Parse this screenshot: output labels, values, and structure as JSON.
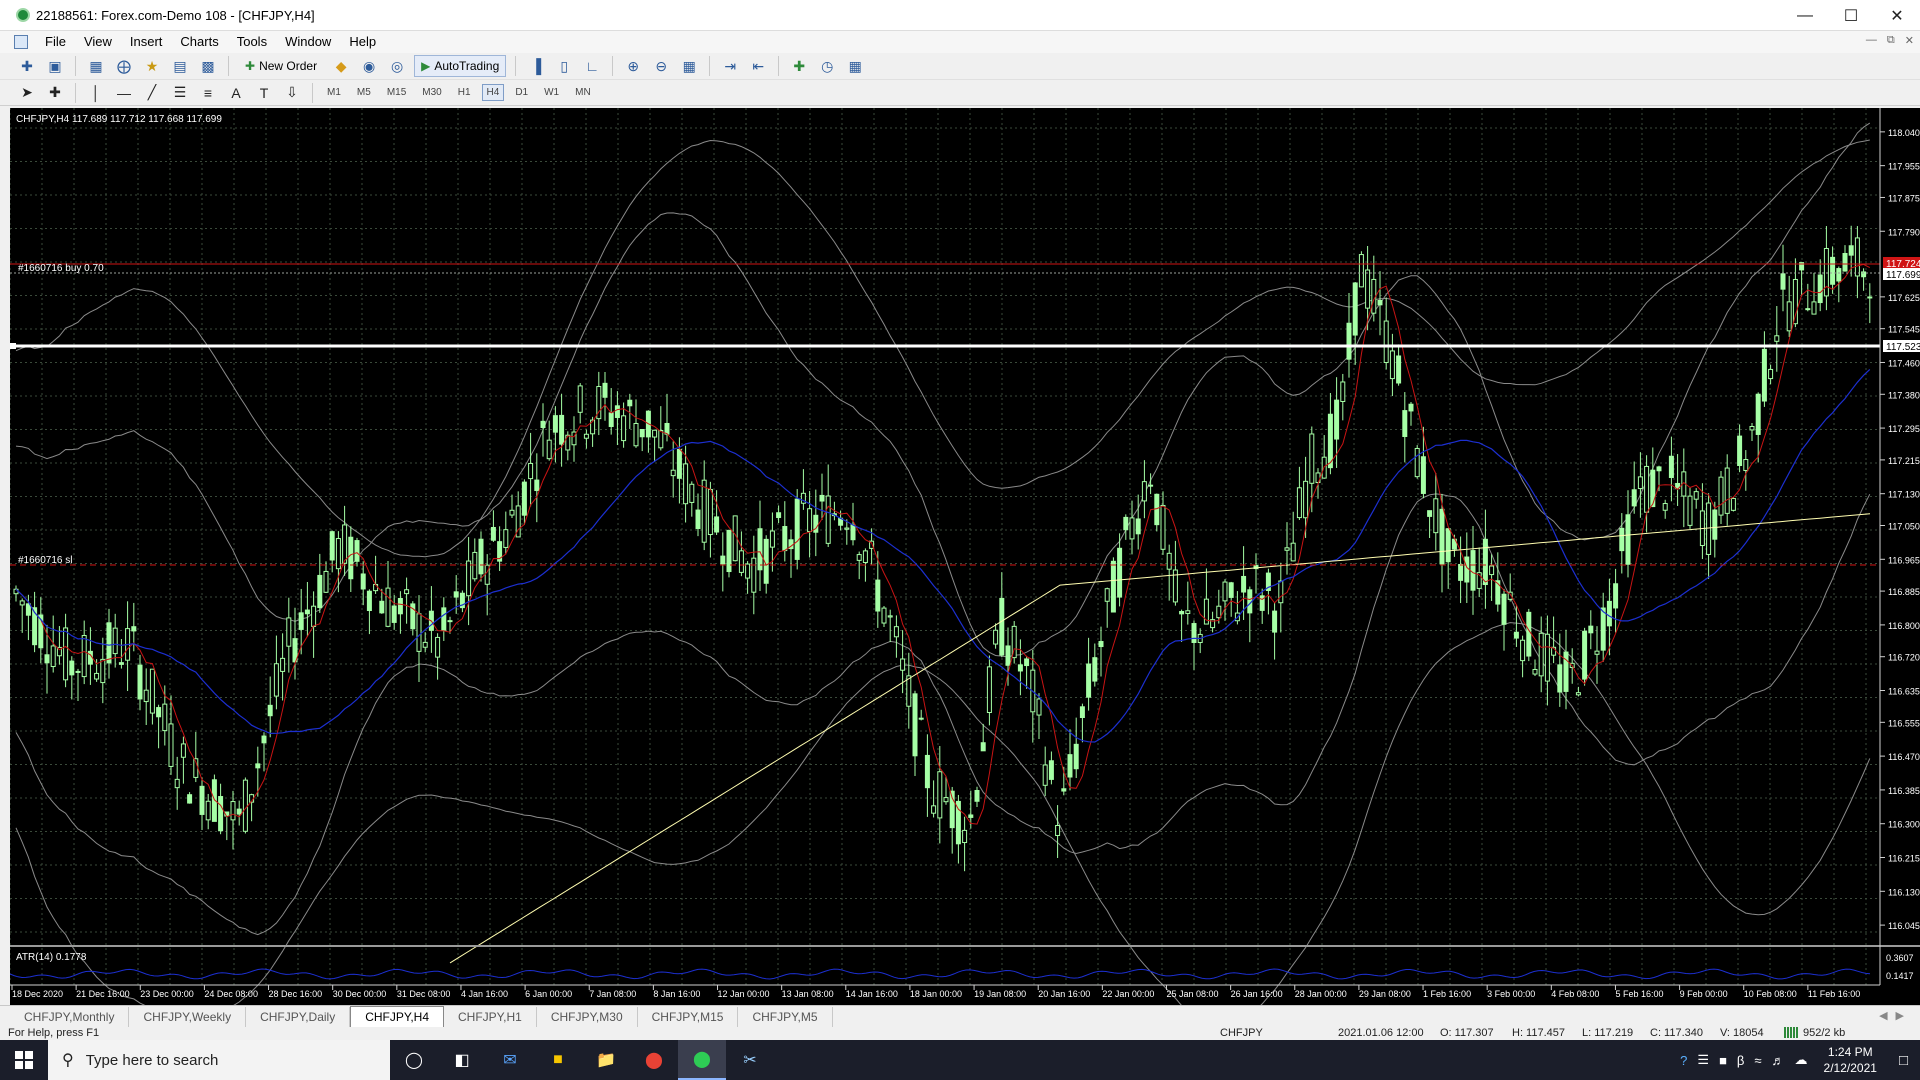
{
  "window": {
    "title": "22188561: Forex.com-Demo 108 - [CHFJPY,H4]"
  },
  "menu": [
    "File",
    "View",
    "Insert",
    "Charts",
    "Tools",
    "Window",
    "Help"
  ],
  "toolbar": {
    "new_order": "New Order",
    "autotrading": "AutoTrading"
  },
  "timeframes": [
    "M1",
    "M5",
    "M15",
    "M30",
    "H1",
    "H4",
    "D1",
    "W1",
    "MN"
  ],
  "active_timeframe": "H4",
  "chart": {
    "header": "CHFJPY,H4  117.689 117.712 117.668 117.699",
    "order_label": "#1660716 buy 0.70",
    "sl_label": "#1660716 sl",
    "price_axis": [
      "118.040",
      "117.955",
      "117.875",
      "117.790",
      "117.625",
      "117.545",
      "117.460",
      "117.380",
      "117.295",
      "117.215",
      "117.130",
      "117.050",
      "116.965",
      "116.885",
      "116.800",
      "116.720",
      "116.635",
      "116.555",
      "116.470",
      "116.385",
      "116.300",
      "116.215",
      "116.130",
      "116.045"
    ],
    "order_price": "117.724",
    "bid_price": "117.699",
    "level_price": "117.523",
    "atr_label": "ATR(14) 0.1778",
    "atr_axis": [
      "0.3607",
      "0.1417"
    ],
    "time_axis": [
      "18 Dec 2020",
      "21 Dec 16:00",
      "23 Dec 00:00",
      "24 Dec 08:00",
      "28 Dec 16:00",
      "30 Dec 00:00",
      "31 Dec 08:00",
      "4 Jan 16:00",
      "6 Jan 00:00",
      "7 Jan 08:00",
      "8 Jan 16:00",
      "12 Jan 00:00",
      "13 Jan 08:00",
      "14 Jan 16:00",
      "18 Jan 00:00",
      "19 Jan 08:00",
      "20 Jan 16:00",
      "22 Jan 00:00",
      "25 Jan 08:00",
      "26 Jan 16:00",
      "28 Jan 00:00",
      "29 Jan 08:00",
      "1 Feb 16:00",
      "3 Feb 00:00",
      "4 Feb 08:00",
      "5 Feb 16:00",
      "9 Feb 00:00",
      "10 Feb 08:00",
      "11 Feb 16:00"
    ],
    "colors": {
      "background": "#000000",
      "candle": "#a6ffa6",
      "grid": "#3a4a3a",
      "order_line": "#d01515",
      "level_line": "#ffffff",
      "ma_fast": "#c81414",
      "ma_mid": "#1c2fd0",
      "ma_slow": "#fffdb0",
      "bands": "#8a8a8a"
    }
  },
  "chart_tabs": [
    "CHFJPY,Monthly",
    "CHFJPY,Weekly",
    "CHFJPY,Daily",
    "CHFJPY,H4",
    "CHFJPY,H1",
    "CHFJPY,M30",
    "CHFJPY,M15",
    "CHFJPY,M5"
  ],
  "active_tab": "CHFJPY,H4",
  "status": {
    "help": "For Help, press F1",
    "symbol": "CHFJPY",
    "datetime": "2021.01.06 12:00",
    "open": "O: 117.307",
    "high": "H: 117.457",
    "low": "L: 117.219",
    "close": "C: 117.340",
    "volume": "V: 18054",
    "traffic": "952/2 kb"
  },
  "taskbar": {
    "search_placeholder": "Type here to search",
    "time": "1:24 PM",
    "date": "2/12/2021"
  }
}
